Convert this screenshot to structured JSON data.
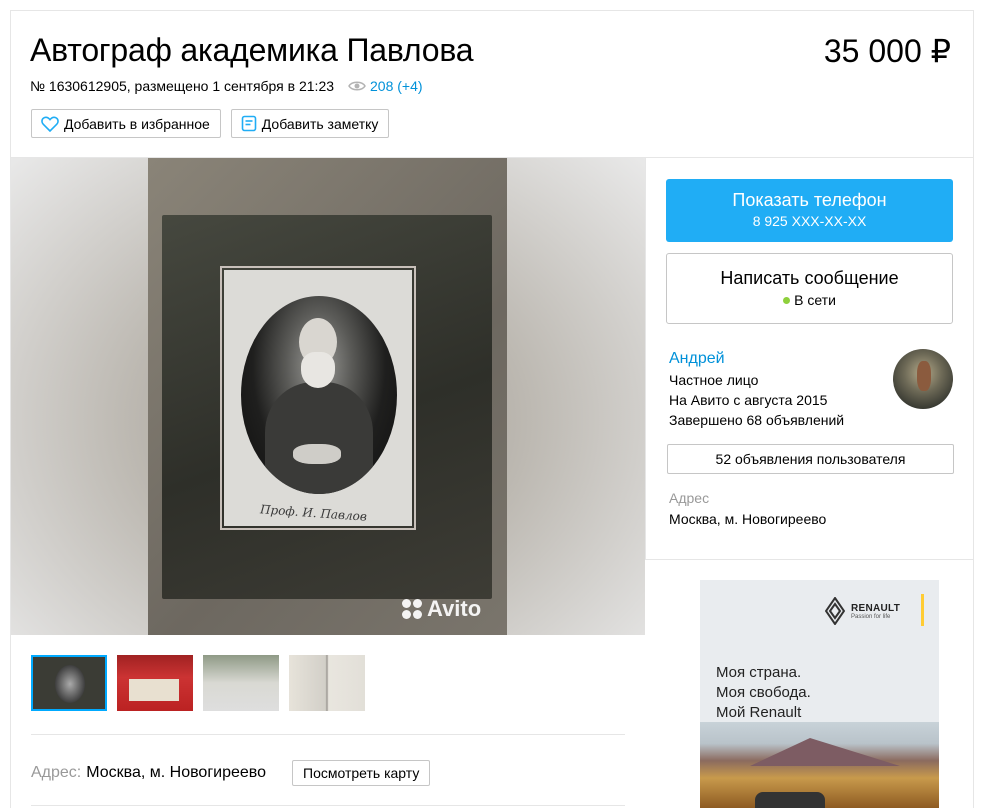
{
  "header": {
    "title": "Автограф академика Павлова",
    "price": "35 000 ₽",
    "meta": "№ 1630612905, размещено 1 сентября в 21:23",
    "views": "208 (+4)",
    "favorite_label": "Добавить в избранное",
    "note_label": "Добавить заметку"
  },
  "gallery": {
    "watermark": "Avito",
    "signature": "Проф. И. Павлов",
    "thumbnails": [
      "photo-1",
      "photo-2",
      "photo-3",
      "photo-4"
    ],
    "active_index": 0
  },
  "address": {
    "label": "Адрес:",
    "value": "Москва, м. Новогиреево",
    "map_button": "Посмотреть карту"
  },
  "sidebar": {
    "phone_button": "Показать телефон",
    "phone_masked": "8 925 XXX-XX-XX",
    "message_button": "Написать сообщение",
    "online_status": "В сети",
    "seller": {
      "name": "Андрей",
      "type": "Частное лицо",
      "since": "На Авито с августа 2015",
      "completed": "Завершено 68 объявлений"
    },
    "ads_button": "52 объявления пользователя",
    "address_label": "Адрес",
    "address_value": "Москва, м. Новогиреево"
  },
  "banner": {
    "brand": "RENAULT",
    "tagline": "Passion for life",
    "line1": "Моя страна.",
    "line2": "Моя свобода.",
    "line3": "Мой Renault"
  },
  "colors": {
    "accent": "#20adf5",
    "link": "#0091d9",
    "online": "#8ed03c",
    "muted": "#999999"
  },
  "icons": [
    "eye-icon",
    "heart-icon",
    "note-icon",
    "online-dot-icon",
    "renault-logo-icon"
  ]
}
